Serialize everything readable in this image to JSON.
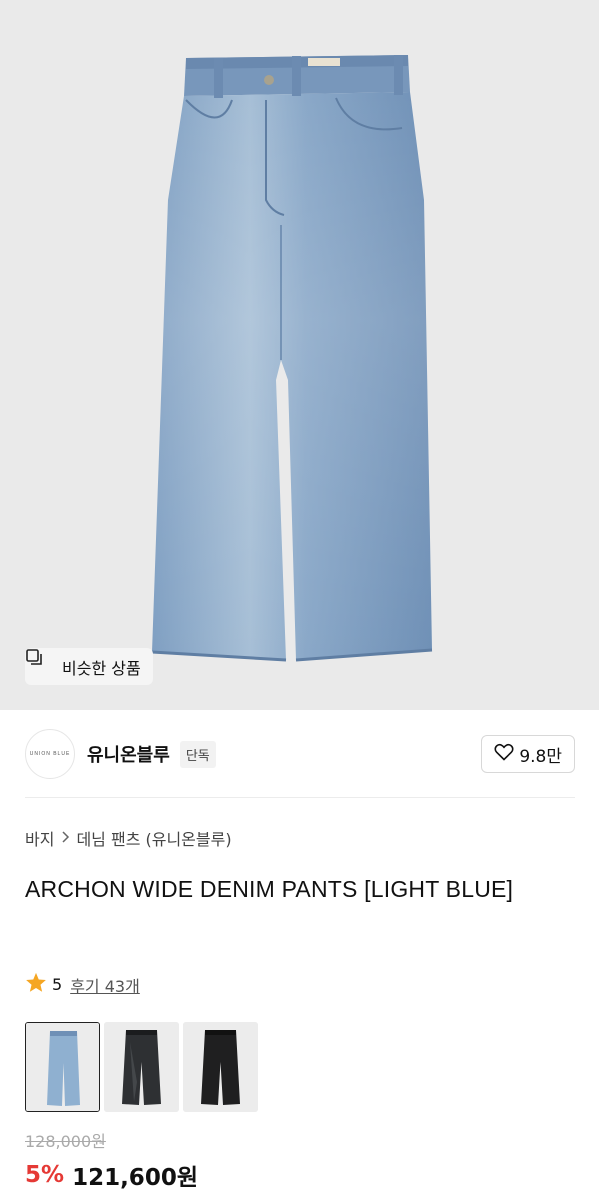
{
  "hero": {
    "image_alt": "light blue wide denim pants",
    "similar_button_label": "비슷한 상품",
    "similar_icon": "similar-items-icon"
  },
  "brand": {
    "logo_text": "UNION BLUE",
    "name": "유니온블루",
    "badge": "단독",
    "like_icon": "heart-outline-icon",
    "like_count": "9.8만"
  },
  "breadcrumb": {
    "items": [
      "바지",
      "데님 팬츠 (유니온블루)"
    ],
    "separator_icon": "chevron-right-icon"
  },
  "product": {
    "title": "ARCHON WIDE DENIM PANTS [LIGHT BLUE]"
  },
  "rating": {
    "star_icon": "star-icon",
    "star_color": "#f5a623",
    "score": "5",
    "review_link": "후기 43개"
  },
  "options": {
    "thumbnails": [
      {
        "label": "light blue",
        "selected": true,
        "color": "#8fb0d0"
      },
      {
        "label": "black washed",
        "selected": false,
        "color": "#2e3033"
      },
      {
        "label": "black",
        "selected": false,
        "color": "#1f1f20"
      }
    ]
  },
  "price": {
    "original": "128,000원",
    "discount": "5%",
    "current": "121,600원",
    "discount_color": "#e53935"
  }
}
